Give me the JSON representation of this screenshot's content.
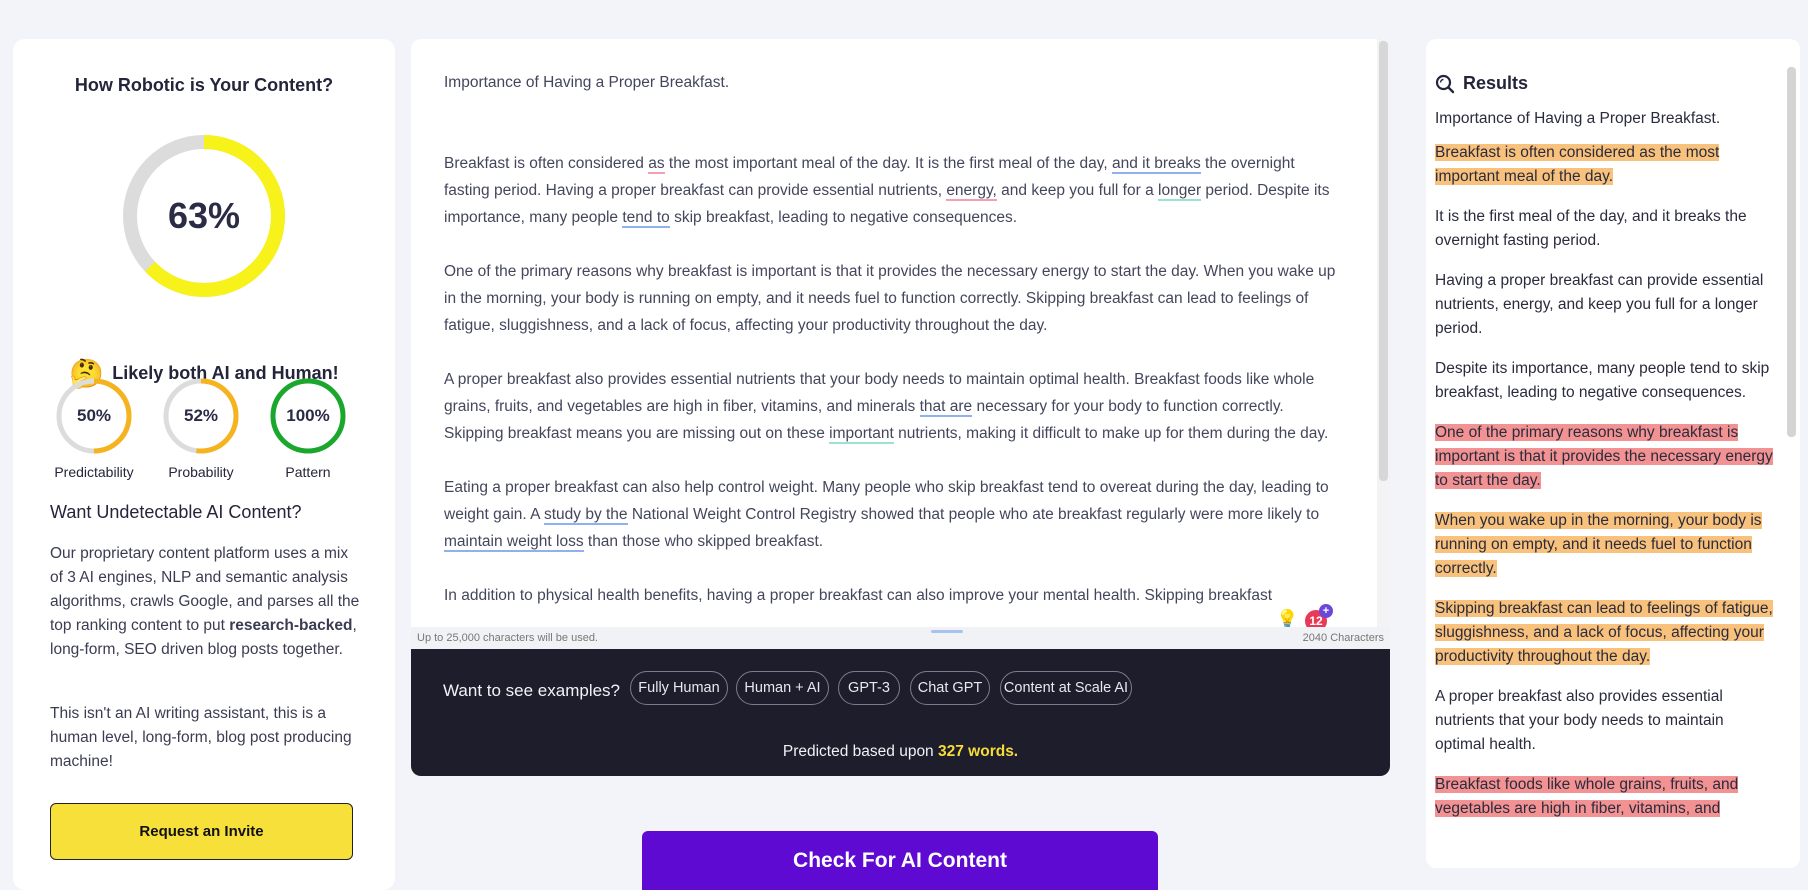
{
  "left": {
    "title": "How Robotic is Your Content?",
    "main_score": "63%",
    "main_score_value": 63,
    "verdict_emoji": "🤔",
    "verdict": "Likely both AI and Human!",
    "metrics": [
      {
        "value": "50%",
        "fraction": 0.5,
        "label": "Predictability",
        "color": "#f5b31d"
      },
      {
        "value": "52%",
        "fraction": 0.52,
        "label": "Probability",
        "color": "#f5b31d"
      },
      {
        "value": "100%",
        "fraction": 1.0,
        "label": "Pattern",
        "color": "#1aa82c"
      }
    ],
    "want_title": "Want Undetectable AI Content?",
    "para1_pre": "Our proprietary content platform uses a mix of 3 AI engines, NLP and semantic analysis algorithms, crawls Google, and parses all the top ranking content to put ",
    "para1_bold": "research-backed",
    "para1_post": ", long-form, SEO driven blog posts together.",
    "para2": "This isn't an AI writing assistant, this is a human level, long-form, blog post producing machine!",
    "invite_label": "Request an Invite"
  },
  "editor": {
    "title_line": "Importance of Having a Proper Breakfast.",
    "p1": {
      "a": "Breakfast is often considered ",
      "u1": "as",
      "b": " the most important meal of the day. It is the first meal of the day, ",
      "u2": "and it breaks",
      "c": " the overnight fasting period. Having a proper breakfast can provide essential nutrients, ",
      "u3": "energy,",
      "d": " and keep you full for a ",
      "u4": "longer",
      "e": " period. Despite its importance, many people ",
      "u5": "tend to",
      "f": " skip breakfast, leading to negative consequences."
    },
    "p2": "One of the primary reasons why breakfast is important is that it provides the necessary energy to start the day. When you wake up in the morning, your body is running on empty, and it needs fuel to function correctly. Skipping breakfast can lead to feelings of fatigue, sluggishness, and a lack of focus, affecting your productivity throughout the day.",
    "p3": {
      "a": "A proper breakfast also provides essential nutrients that your body needs to maintain optimal health. Breakfast foods like whole grains, fruits, and vegetables are high in fiber, vitamins, and minerals ",
      "u1": "that are",
      "b": " necessary for your body to function correctly. Skipping breakfast means you are missing out on these ",
      "u2": "important",
      "c": " nutrients, making it difficult to make up for them during the day."
    },
    "p4": {
      "a": "Eating a proper breakfast can also help control weight. Many people who skip breakfast tend to overeat during the day, leading to weight gain. A ",
      "u1": "study by the",
      "b": " National Weight Control Registry showed that people who ate breakfast regularly were more likely to ",
      "u2": "maintain weight loss",
      "c": " than those who skipped breakfast."
    },
    "p5": "In addition to physical health benefits, having a proper breakfast can also improve your mental health. Skipping breakfast",
    "limit_note": "Up to 25,000 characters will be used.",
    "char_count": "2040 Characters",
    "bulb_icon": "💡",
    "grammar_count": "12",
    "grammar_plus": "+"
  },
  "examples": {
    "label": "Want to see examples?",
    "chips": [
      "Fully Human",
      "Human + AI",
      "GPT-3",
      "Chat GPT",
      "Content at Scale AI"
    ],
    "predicted_pre": "Predicted based upon ",
    "predicted_words": "327 words."
  },
  "check_button": "Check For AI Content",
  "results": {
    "title": "Results",
    "items": [
      {
        "text": "Importance of Having a Proper Breakfast.",
        "level": "none"
      },
      {
        "text": "Breakfast is often considered as the most important meal of the day.",
        "level": "orange"
      },
      {
        "text": "It is the first meal of the day, and it breaks the overnight fasting period.",
        "level": "none"
      },
      {
        "text": "Having a proper breakfast can provide essential nutrients, energy, and keep you full for a longer period.",
        "level": "none"
      },
      {
        "text": "Despite its importance, many people tend to skip breakfast, leading to negative consequences.",
        "level": "none"
      },
      {
        "text": "One of the primary reasons why breakfast is important is that it provides the necessary energy to start the day.",
        "level": "red"
      },
      {
        "text": "When you wake up in the morning, your body is running on empty, and it needs fuel to function correctly.",
        "level": "orange"
      },
      {
        "text": "Skipping breakfast can lead to feelings of fatigue, sluggishness, and a lack of focus, affecting your productivity throughout the day.",
        "level": "orange"
      },
      {
        "text": "A proper breakfast also provides essential nutrients that your body needs to maintain optimal health.",
        "level": "none"
      },
      {
        "text": "Breakfast foods like whole grains, fruits, and vegetables are high in fiber, vitamins, and",
        "level": "red"
      }
    ]
  },
  "colors": {
    "gauge_main": "#f7f21a",
    "gauge_track": "#dcdcdc",
    "accent_purple": "#5e0ad3",
    "invite_yellow": "#f8e03b",
    "highlight_orange": "#f9c27c",
    "highlight_red": "#f29292"
  }
}
